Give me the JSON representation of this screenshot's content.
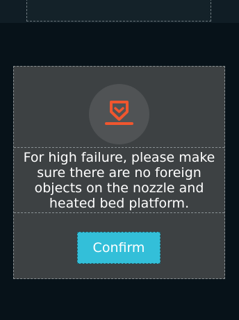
{
  "dialog": {
    "icon": "nozzle-warning-icon",
    "message": "For high failure, please make sure there are no foreign objects on the nozzle and heated bed platform.",
    "confirm_label": "Confirm"
  },
  "colors": {
    "background": "#071219",
    "dialog_bg": "#3d4143",
    "icon_circle": "#505355",
    "icon_accent": "#f0562e",
    "button": "#33bfd9",
    "text": "#ffffff"
  }
}
